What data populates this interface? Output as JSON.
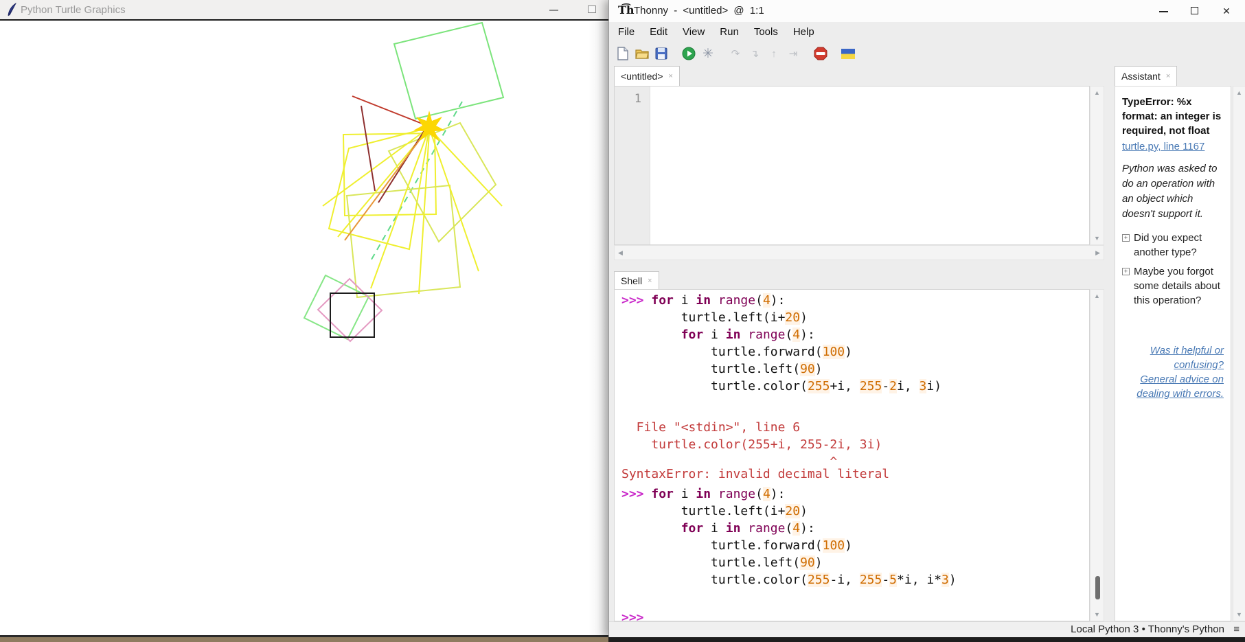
{
  "colors": {
    "canvas_green": "#7be47b",
    "canvas_light_green": "#86e686",
    "canvas_teal_dash": "#5fd98a",
    "canvas_yellow": "#efef2f",
    "canvas_yellow_green": "#d9e65a",
    "canvas_red": "#c0392b",
    "canvas_dark_red": "#8e2f2f",
    "canvas_orange": "#e8973a",
    "canvas_pink": "#e49ac2",
    "canvas_black": "#1c1c1c",
    "turtle_star_yellow": "#fcd703",
    "prompt_magenta": "#c928c9",
    "keyword_plum": "#7f0055",
    "number_orange": "#cf6c00",
    "error_red": "#c23a3a",
    "link_blue": "#4a7ab5"
  },
  "icons": {
    "close": "✕",
    "tab_close": "×",
    "burger": "≡",
    "up": "▲",
    "down": "▼",
    "left": "◀",
    "right": "▶",
    "expand": "+",
    "debug_star": "✳"
  },
  "turtle_window": {
    "title": "Python Turtle Graphics"
  },
  "thonny": {
    "title": "Thonny - <untitled> @ 1:1",
    "menu": [
      "File",
      "Edit",
      "View",
      "Run",
      "Tools",
      "Help"
    ],
    "toolbar_icons": [
      "new-file",
      "open-file",
      "save-file",
      "run-current-script",
      "debug-current-script",
      "step-over",
      "step-into",
      "step-out",
      "resume",
      "stop",
      "ukraine-support-flag"
    ],
    "editor": {
      "tab_label": "<untitled>",
      "line_number": "1"
    },
    "shell": {
      "tab_label": "Shell",
      "lines": [
        {
          "s": [
            [
              "p",
              ">>> "
            ],
            [
              "k",
              "for"
            ],
            [
              "d",
              " i "
            ],
            [
              "k",
              "in"
            ],
            [
              "d",
              " "
            ],
            [
              "b",
              "range"
            ],
            [
              "d",
              "("
            ],
            [
              "n",
              "4"
            ],
            [
              "d",
              "):"
            ]
          ]
        },
        {
          "s": [
            [
              "d",
              "        turtle.left(i+"
            ],
            [
              "n",
              "20"
            ],
            [
              "d",
              ")"
            ]
          ]
        },
        {
          "s": [
            [
              "d",
              "        "
            ],
            [
              "k",
              "for"
            ],
            [
              "d",
              " i "
            ],
            [
              "k",
              "in"
            ],
            [
              "d",
              " "
            ],
            [
              "b",
              "range"
            ],
            [
              "d",
              "("
            ],
            [
              "n",
              "4"
            ],
            [
              "d",
              "):"
            ]
          ]
        },
        {
          "s": [
            [
              "d",
              "            turtle.forward("
            ],
            [
              "n",
              "100"
            ],
            [
              "d",
              ")"
            ]
          ]
        },
        {
          "s": [
            [
              "d",
              "            turtle.left("
            ],
            [
              "n",
              "90"
            ],
            [
              "d",
              ")"
            ]
          ]
        },
        {
          "s": [
            [
              "d",
              "            turtle.color("
            ],
            [
              "n",
              "255"
            ],
            [
              "d",
              "+i, "
            ],
            [
              "n",
              "255"
            ],
            [
              "d",
              "-"
            ],
            [
              "n",
              "2"
            ],
            [
              "d",
              "i, "
            ],
            [
              "n",
              "3"
            ],
            [
              "d",
              "i)"
            ]
          ]
        },
        {
          "s": []
        },
        {
          "s": [
            [
              "e",
              "  File \"<stdin>\", line 6"
            ]
          ],
          "mt": 10
        },
        {
          "s": [
            [
              "e",
              "    turtle.color(255+i, 255-2i, 3i)"
            ]
          ]
        },
        {
          "s": [
            [
              "e",
              "                            ^"
            ]
          ],
          "h": 16
        },
        {
          "s": [
            [
              "e",
              "SyntaxError: invalid decimal literal"
            ]
          ],
          "mt": 2
        },
        {
          "s": [
            [
              "p",
              ">>> "
            ],
            [
              "k",
              "for"
            ],
            [
              "d",
              " i "
            ],
            [
              "k",
              "in"
            ],
            [
              "d",
              " "
            ],
            [
              "b",
              "range"
            ],
            [
              "d",
              "("
            ],
            [
              "n",
              "4"
            ],
            [
              "d",
              "):"
            ]
          ],
          "mt": 4
        },
        {
          "s": [
            [
              "d",
              "        turtle.left(i+"
            ],
            [
              "n",
              "20"
            ],
            [
              "d",
              ")"
            ]
          ]
        },
        {
          "s": [
            [
              "d",
              "        "
            ],
            [
              "k",
              "for"
            ],
            [
              "d",
              " i "
            ],
            [
              "k",
              "in"
            ],
            [
              "d",
              " "
            ],
            [
              "b",
              "range"
            ],
            [
              "d",
              "("
            ],
            [
              "n",
              "4"
            ],
            [
              "d",
              "):"
            ]
          ]
        },
        {
          "s": [
            [
              "d",
              "            turtle.forward("
            ],
            [
              "n",
              "100"
            ],
            [
              "d",
              ")"
            ]
          ]
        },
        {
          "s": [
            [
              "d",
              "            turtle.left("
            ],
            [
              "n",
              "90"
            ],
            [
              "d",
              ")"
            ]
          ]
        },
        {
          "s": [
            [
              "d",
              "            turtle.color("
            ],
            [
              "n",
              "255"
            ],
            [
              "d",
              "-i, "
            ],
            [
              "n",
              "255"
            ],
            [
              "d",
              "-"
            ],
            [
              "n",
              "5"
            ],
            [
              "d",
              "*i, i*"
            ],
            [
              "n",
              "3"
            ],
            [
              "d",
              ")"
            ]
          ]
        },
        {
          "s": [
            [
              "p",
              ">>>"
            ]
          ],
          "mt": 30
        }
      ]
    },
    "assistant": {
      "tab_label": "Assistant",
      "error_title": "TypeError: %x format: an integer is required, not float",
      "error_location_link": "turtle.py, line 1167",
      "explanation": "Python was asked to do an operation with an object which doesn't support it.",
      "suggestions": [
        "Did you expect another type?",
        "Maybe you forgot some details about this operation?"
      ],
      "feedback_link": "Was it helpful or confusing?",
      "advice_link": "General advice on dealing with errors."
    },
    "statusbar": {
      "interpreter": "Local Python 3",
      "separator": "•",
      "backend": "Thonny's Python"
    }
  }
}
